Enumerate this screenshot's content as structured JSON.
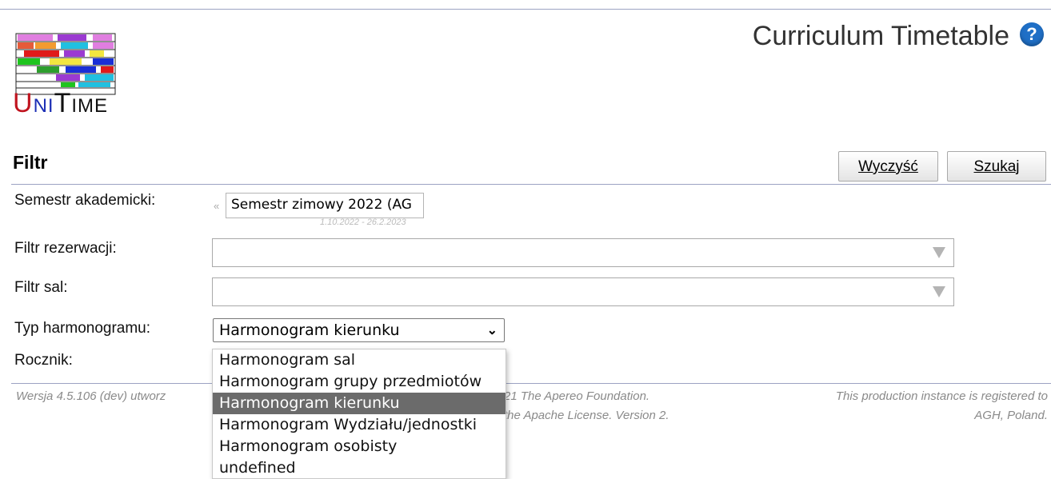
{
  "header": {
    "logo_text": "UniTime",
    "title": "Curriculum Timetable",
    "help_icon": "question-circle-icon"
  },
  "filter": {
    "heading": "Filtr",
    "clear_button": "Wyczyść",
    "search_button": "Szukaj",
    "rows": {
      "session_label": "Semestr akademicki:",
      "reservation_label": "Filtr rezerwacji:",
      "rooms_label": "Filtr sal:",
      "type_label": "Typ harmonogramu:",
      "year_label": "Rocznik:"
    },
    "session": {
      "value": "Semestr zimowy 2022 (AG",
      "dates": "1.10.2022 - 26.2.2023"
    },
    "reservation_value": "",
    "rooms_value": "",
    "type_value": "Harmonogram kierunku",
    "type_options": [
      "Harmonogram sal",
      "Harmonogram grupy przedmiotów",
      "Harmonogram kierunku",
      "Harmonogram Wydziału/jednostki",
      "Harmonogram osobisty",
      "undefined"
    ],
    "type_selected_index": 2
  },
  "footer": {
    "left": "Wersja 4.5.106 (dev) utworz",
    "mid_line1": "21 The Apereo Foundation.",
    "mid_line2": "the Apache License. Version 2.",
    "right_line1": "This production instance is registered to",
    "right_line2": "AGH, Poland."
  },
  "colors": {
    "rule": "#9ca3c3",
    "selected_option": "#6b6b6b",
    "help_icon": "#1f6fc6"
  }
}
